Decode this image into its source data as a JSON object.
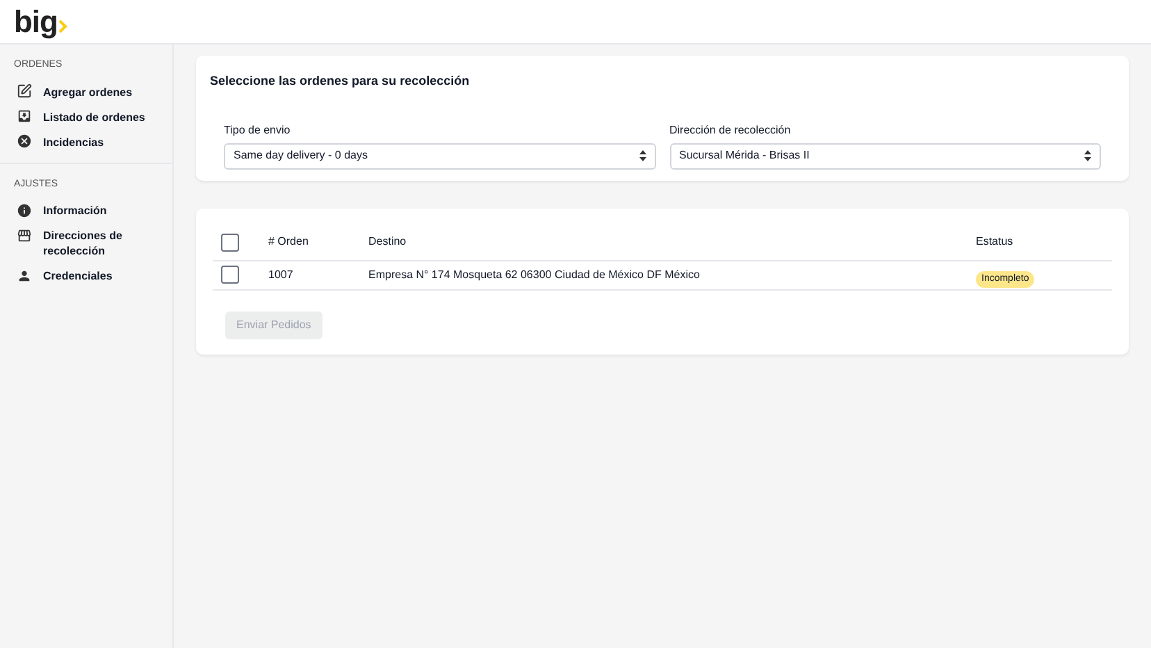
{
  "logo": {
    "text": "big"
  },
  "sidebar": {
    "sections": [
      {
        "title": "ORDENES",
        "items": [
          {
            "label": "Agregar ordenes"
          },
          {
            "label": "Listado de ordenes"
          },
          {
            "label": "Incidencias"
          }
        ]
      },
      {
        "title": "AJUSTES",
        "items": [
          {
            "label": "Información"
          },
          {
            "label": "Direcciones de recolección"
          },
          {
            "label": "Credenciales"
          }
        ]
      }
    ]
  },
  "form_card": {
    "title": "Seleccione las ordenes para su recolección",
    "fields": [
      {
        "label": "Tipo de envio",
        "value": "Same day delivery - 0 days"
      },
      {
        "label": "Dirección de recolección",
        "value": "Sucursal Mérida - Brisas II"
      }
    ]
  },
  "table": {
    "select_all_checked": false,
    "columns": [
      "# Orden",
      "Destino",
      "Estatus"
    ],
    "rows": [
      {
        "checked": false,
        "order": "1007",
        "destination": "Empresa N° 174 Mosqueta 62 06300 Ciudad de México DF México",
        "status": "Incompleto",
        "color": "#fde68a"
      }
    ]
  },
  "submit_button": {
    "label": "Enviar Pedidos",
    "disabled": true
  }
}
